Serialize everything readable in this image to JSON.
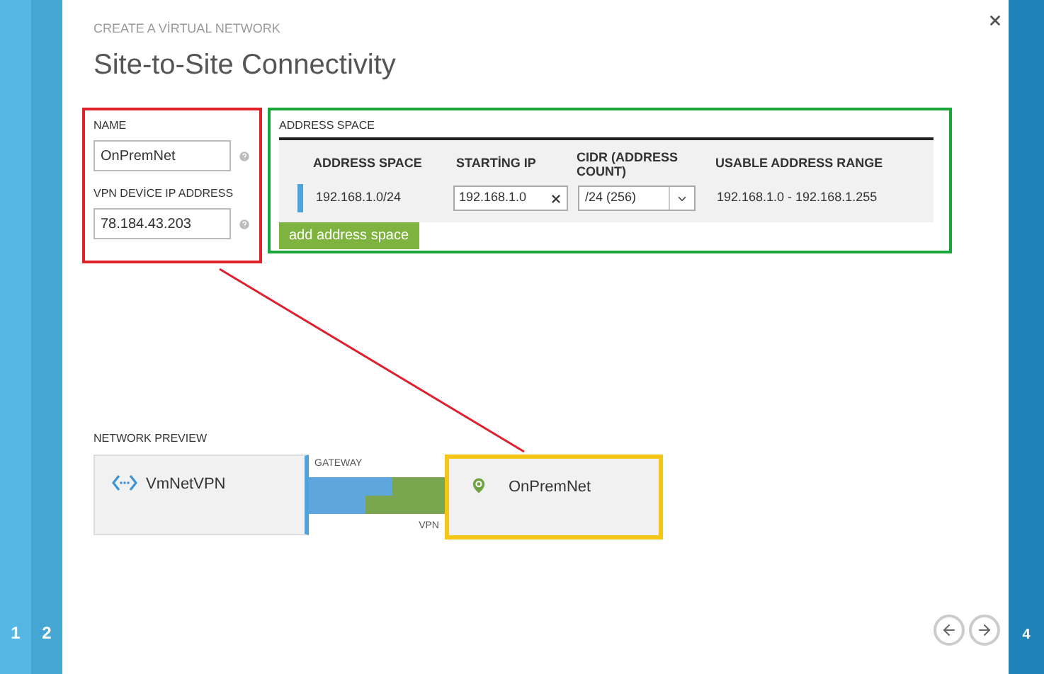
{
  "left_steps": [
    "1",
    "2"
  ],
  "right_steps": [
    "4"
  ],
  "eyebrow": "CREATE A VİRTUAL NETWORK",
  "title": "Site-to-Site Connectivity",
  "fields": [
    {
      "label": "NAME",
      "value": "OnPremNet"
    },
    {
      "label": "VPN DEVİCE IP ADDRESS",
      "value": "78.184.43.203"
    }
  ],
  "address_space": {
    "heading": "ADDRESS SPACE",
    "columns": [
      "ADDRESS SPACE",
      "STARTİNG IP",
      "CIDR (ADDRESS COUNT)",
      "USABLE ADDRESS RANGE"
    ],
    "rows": [
      {
        "address_space": "192.168.1.0/24",
        "starting_ip": "192.168.1.0",
        "cidr": "/24 (256)",
        "usable_range": "192.168.1.0 - 192.168.1.255"
      }
    ],
    "add_button": "add address space"
  },
  "preview": {
    "heading": "NETWORK PREVIEW",
    "virtual_network": "VmNetVPN",
    "gateway_label": "GATEWAY",
    "vpn_label": "VPN",
    "local_network": "OnPremNet"
  }
}
